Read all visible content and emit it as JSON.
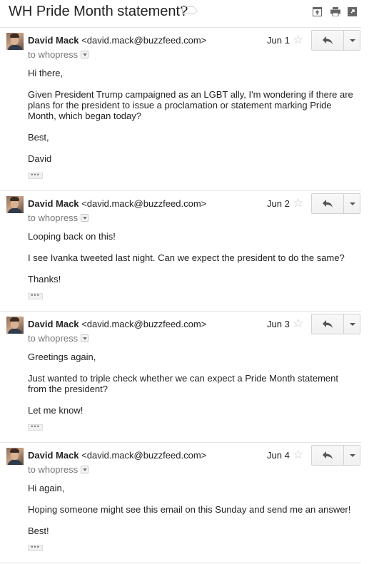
{
  "thread": {
    "subject": "WH Pride Month statement?"
  },
  "toolbar": {
    "icons": [
      "archive-icon",
      "print-icon",
      "open-new-window-icon"
    ]
  },
  "messages": [
    {
      "sender_name": "David Mack",
      "sender_email": "<david.mack@buzzfeed.com>",
      "recipient": "to whopress",
      "date": "Jun 1",
      "paragraphs": [
        "Hi there,",
        "Given President Trump campaigned as an LGBT ally, I'm wondering if there are plans for the president to issue a proclamation or statement marking Pride Month, which began today?",
        "Best,",
        "David"
      ]
    },
    {
      "sender_name": "David Mack",
      "sender_email": "<david.mack@buzzfeed.com>",
      "recipient": "to whopress",
      "date": "Jun 2",
      "paragraphs": [
        "Looping back on this!",
        "I see Ivanka tweeted last night. Can we expect the president to do the same?",
        "Thanks!"
      ]
    },
    {
      "sender_name": "David Mack",
      "sender_email": "<david.mack@buzzfeed.com>",
      "recipient": "to whopress",
      "date": "Jun 3",
      "paragraphs": [
        "Greetings again,",
        "Just wanted to triple check whether we can expect a Pride Month statement from the president?",
        "Let me know!"
      ]
    },
    {
      "sender_name": "David Mack",
      "sender_email": "<david.mack@buzzfeed.com>",
      "recipient": "to whopress",
      "date": "Jun 4",
      "paragraphs": [
        "Hi again,",
        "Hoping someone might see this email on this Sunday and send me an answer!",
        "Best!"
      ]
    }
  ],
  "colors": {
    "text": "#222222",
    "muted": "#777777",
    "divider": "#e5e5e5",
    "button_border": "#d2d2d2"
  }
}
